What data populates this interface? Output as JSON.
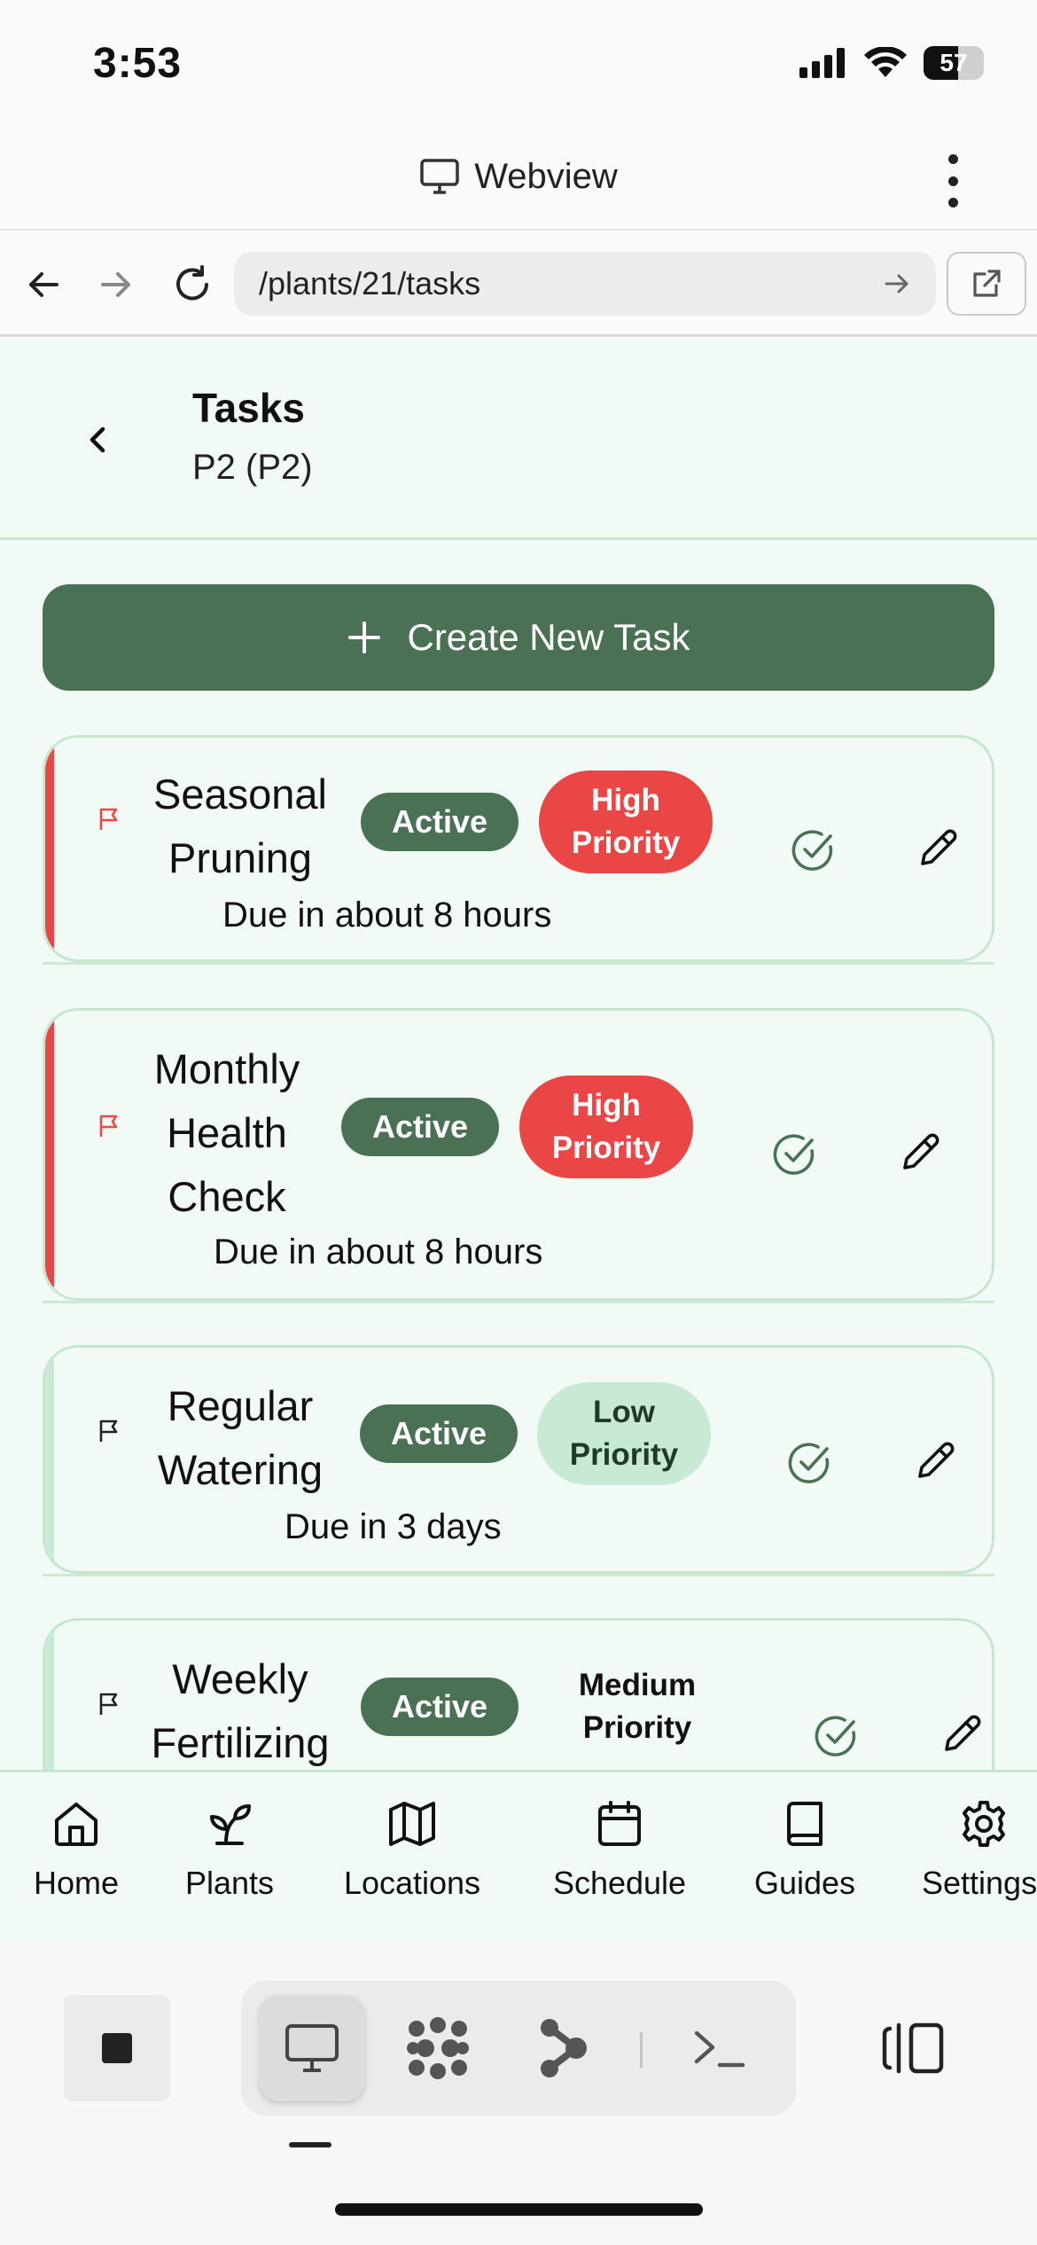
{
  "status_bar": {
    "time": "3:53",
    "battery_level": "57",
    "battery_fraction": 0.57
  },
  "webview": {
    "title": "Webview",
    "url": "/plants/21/tasks"
  },
  "page": {
    "title": "Tasks",
    "subtitle": "P2 (P2)",
    "create_button_label": "Create New Task"
  },
  "tasks": [
    {
      "title_lines": [
        "Seasonal",
        "Pruning"
      ],
      "status": "Active",
      "priority_lines": [
        "High",
        "Priority"
      ],
      "priority": "high",
      "due": "Due in about 8 hours",
      "flag_color": "#e94b4b"
    },
    {
      "title_lines": [
        "Monthly",
        "Health",
        "Check"
      ],
      "status": "Active",
      "priority_lines": [
        "High",
        "Priority"
      ],
      "priority": "high",
      "due": "Due in about 8 hours",
      "flag_color": "#e94b4b"
    },
    {
      "title_lines": [
        "Regular",
        "Watering"
      ],
      "status": "Active",
      "priority_lines": [
        "Low",
        "Priority"
      ],
      "priority": "low",
      "due": "Due in 3 days",
      "flag_color": "#222222"
    },
    {
      "title_lines": [
        "Weekly",
        "Fertilizing"
      ],
      "status": "Active",
      "priority_lines": [
        "Medium",
        "Priority"
      ],
      "priority": "medium",
      "due": "",
      "flag_color": "#222222"
    }
  ],
  "bottom_nav": {
    "items": [
      {
        "label": "Home",
        "icon": "home-icon"
      },
      {
        "label": "Plants",
        "icon": "sprout-icon"
      },
      {
        "label": "Locations",
        "icon": "map-icon"
      },
      {
        "label": "Schedule",
        "icon": "calendar-icon"
      },
      {
        "label": "Guides",
        "icon": "book-icon"
      },
      {
        "label": "Settings",
        "icon": "gear-icon"
      }
    ]
  },
  "colors": {
    "brand_green": "#4a7153",
    "high_priority": "#ea4646",
    "low_priority_bg": "#c8e9d3",
    "app_background": "#f1faf4"
  }
}
